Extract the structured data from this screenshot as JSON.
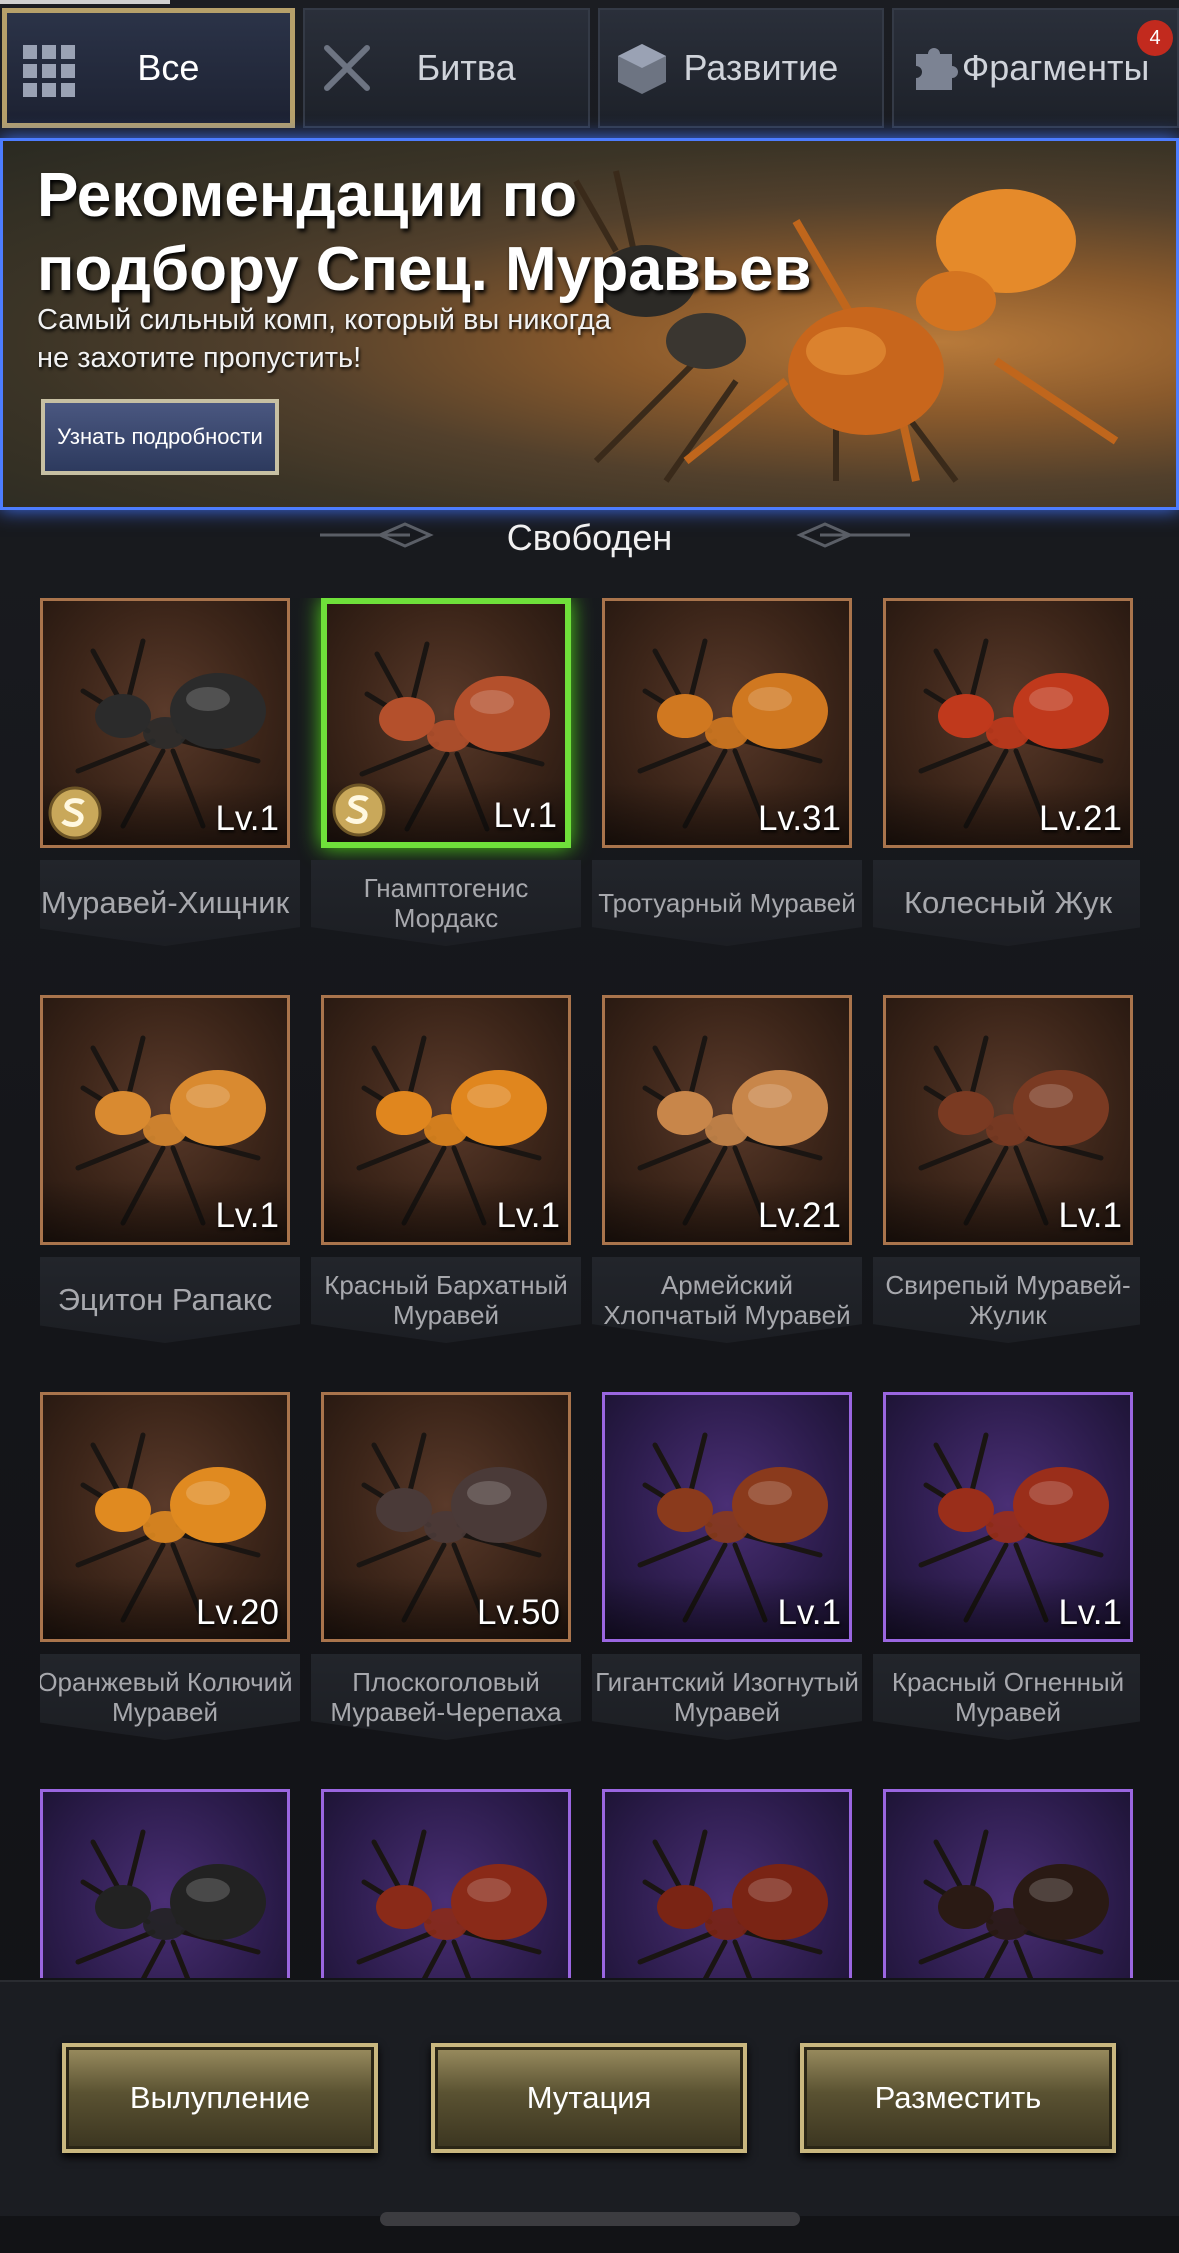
{
  "tabs": [
    {
      "label": "Все",
      "icon": "grid-icon",
      "active": true
    },
    {
      "label": "Битва",
      "icon": "crossed-swords-icon"
    },
    {
      "label": "Развитие",
      "icon": "cube-icon"
    },
    {
      "label": "Фрагменты",
      "icon": "puzzle-icon",
      "badge": "4"
    }
  ],
  "banner": {
    "title_line1": "Рекомендации по",
    "title_line2": "подбору Спец. Муравьев",
    "subtitle_line1": "Самый сильный комп, который вы никогда",
    "subtitle_line2": "не захотите пропустить!",
    "button": "Узнать подробности"
  },
  "section_title": "Свободен",
  "ants": [
    {
      "name": "Муравей-Хищник",
      "level": "Lv.1",
      "special": true,
      "frame": "bronze",
      "color": "#2b2b2b"
    },
    {
      "name": "Гнамптогенис Мордакс",
      "level": "Lv.1",
      "special": true,
      "frame": "selected",
      "color": "#b4502c"
    },
    {
      "name": "Тротуарный Муравей",
      "level": "Lv.31",
      "frame": "bronze",
      "color": "#d07820"
    },
    {
      "name": "Колесный Жук",
      "level": "Lv.21",
      "frame": "bronze",
      "color": "#c0391c"
    },
    {
      "name": "Эцитон Рапакс",
      "level": "Lv.1",
      "frame": "bronze",
      "color": "#d98a30"
    },
    {
      "name": "Красный Бархатный Муравей",
      "level": "Lv.1",
      "frame": "bronze",
      "color": "#e0861e"
    },
    {
      "name": "Армейский Хлопчатый Муравей",
      "level": "Lv.21",
      "frame": "bronze",
      "color": "#c8864a"
    },
    {
      "name": "Свирепый Муравей-Жулик",
      "level": "Lv.1",
      "frame": "bronze",
      "color": "#7a3a22"
    },
    {
      "name": "Оранжевый Колючий Муравей",
      "level": "Lv.20",
      "frame": "bronze",
      "color": "#e08a20"
    },
    {
      "name": "Плоскоголовый Муравей-Черепаха",
      "level": "Lv.50",
      "frame": "bronze",
      "color": "#4a3a38"
    },
    {
      "name": "Гигантский Изогнутый Муравей",
      "level": "Lv.1",
      "frame": "purple",
      "color": "#8a3a1c"
    },
    {
      "name": "Красный Огненный Муравей",
      "level": "Lv.1",
      "frame": "purple",
      "color": "#9a2e1a"
    },
    {
      "name": "",
      "level": "",
      "frame": "purple",
      "color": "#222222"
    },
    {
      "name": "",
      "level": "",
      "frame": "purple",
      "color": "#8a2a18"
    },
    {
      "name": "",
      "level": "",
      "frame": "purple",
      "color": "#7a2414"
    },
    {
      "name": "",
      "level": "",
      "frame": "purple",
      "color": "#2a1a14"
    }
  ],
  "bottom_buttons": [
    "Вылупление",
    "Мутация",
    "Разместить"
  ]
}
